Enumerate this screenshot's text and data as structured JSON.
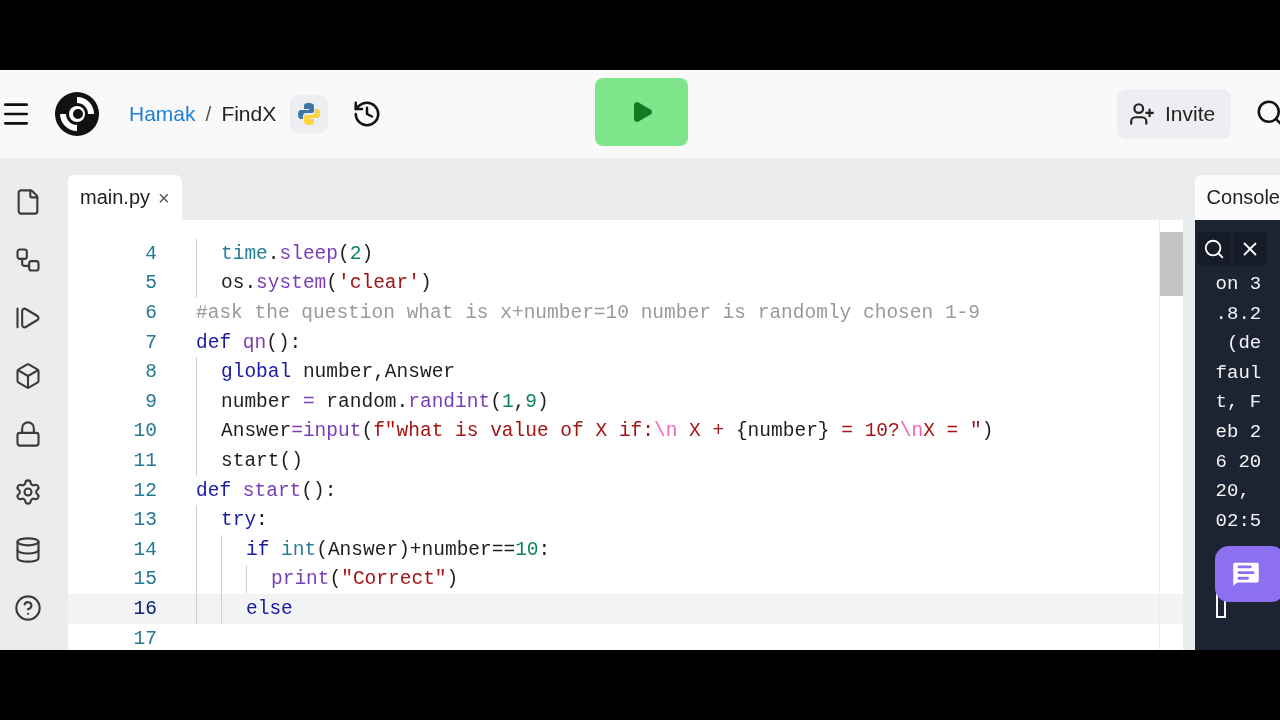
{
  "header": {
    "owner": "Hamak",
    "separator": "/",
    "project": "FindX",
    "invite_label": "Invite"
  },
  "sidebar": {
    "items": [
      {
        "kind": "files"
      },
      {
        "kind": "git"
      },
      {
        "kind": "debugger"
      },
      {
        "kind": "packages"
      },
      {
        "kind": "secrets"
      },
      {
        "kind": "settings"
      },
      {
        "kind": "database"
      },
      {
        "kind": "help"
      }
    ]
  },
  "editor_tabs": [
    {
      "label": "main.py",
      "selected": true,
      "close": "×"
    }
  ],
  "code": {
    "lines": [
      {
        "children": [
          {
            "number": "4",
            "current": false,
            "tokens": [
              {
                "text": "time",
                "kind": "builtin"
              },
              {
                "text": ".",
                "kind": "plain"
              },
              {
                "text": "sleep",
                "kind": "function"
              },
              {
                "text": "(",
                "kind": "plain"
              },
              {
                "text": "2",
                "kind": "number"
              },
              {
                "text": ")",
                "kind": "plain"
              }
            ]
          },
          {
            "number": "5",
            "current": false,
            "tokens": [
              {
                "text": "os.",
                "kind": "plain"
              },
              {
                "text": "system",
                "kind": "function"
              },
              {
                "text": "(",
                "kind": "plain"
              },
              {
                "text": "'clear'",
                "kind": "string"
              },
              {
                "text": ")",
                "kind": "plain"
              }
            ]
          }
        ]
      },
      {
        "number": "6",
        "current": false,
        "tokens": [
          {
            "text": "#ask the question what is x+number=10 number is randomly chosen 1-9",
            "kind": "comment"
          }
        ]
      },
      {
        "number": "7",
        "current": false,
        "tokens": [
          {
            "text": "def ",
            "kind": "keyword"
          },
          {
            "text": "qn",
            "kind": "function"
          },
          {
            "text": "():",
            "kind": "plain"
          }
        ],
        "children": [
          {
            "number": "8",
            "current": false,
            "tokens": [
              {
                "text": "global ",
                "kind": "keyword"
              },
              {
                "text": "number,Answer",
                "kind": "plain"
              }
            ]
          },
          {
            "number": "9",
            "current": false,
            "tokens": [
              {
                "text": "number ",
                "kind": "plain"
              },
              {
                "text": "=",
                "kind": "operator"
              },
              {
                "text": " random.",
                "kind": "plain"
              },
              {
                "text": "randint",
                "kind": "function"
              },
              {
                "text": "(",
                "kind": "plain"
              },
              {
                "text": "1",
                "kind": "number"
              },
              {
                "text": ",",
                "kind": "plain"
              },
              {
                "text": "9",
                "kind": "number"
              },
              {
                "text": ")",
                "kind": "plain"
              }
            ]
          },
          {
            "number": "10",
            "current": false,
            "tokens": [
              {
                "text": "Answer",
                "kind": "plain"
              },
              {
                "text": "=",
                "kind": "operator"
              },
              {
                "text": "input",
                "kind": "function"
              },
              {
                "text": "(",
                "kind": "plain"
              },
              {
                "text": "f\"what is value of X if:",
                "kind": "string"
              },
              {
                "text": "\\n",
                "kind": "escape"
              },
              {
                "text": " X + ",
                "kind": "string"
              },
              {
                "text": "{number}",
                "kind": "plain"
              },
              {
                "text": " = 10?",
                "kind": "string"
              },
              {
                "text": "\\n",
                "kind": "escape"
              },
              {
                "text": "X = \"",
                "kind": "string"
              },
              {
                "text": ")",
                "kind": "plain"
              }
            ]
          },
          {
            "number": "11",
            "current": false,
            "tokens": [
              {
                "text": "start()",
                "kind": "plain"
              }
            ]
          }
        ]
      },
      {
        "number": "12",
        "current": false,
        "tokens": [
          {
            "text": "def ",
            "kind": "keyword"
          },
          {
            "text": "start",
            "kind": "function"
          },
          {
            "text": "():",
            "kind": "plain"
          }
        ],
        "children": [
          {
            "number": "13",
            "current": false,
            "tokens": [
              {
                "text": "try",
                "kind": "keyword"
              },
              {
                "text": ":",
                "kind": "plain"
              }
            ],
            "children": [
              {
                "number": "14",
                "current": false,
                "tokens": [
                  {
                    "text": "if ",
                    "kind": "keyword"
                  },
                  {
                    "text": "int",
                    "kind": "builtin"
                  },
                  {
                    "text": "(Answer)+number==",
                    "kind": "plain"
                  },
                  {
                    "text": "10",
                    "kind": "number"
                  },
                  {
                    "text": ":",
                    "kind": "plain"
                  }
                ],
                "children": [
                  {
                    "number": "15",
                    "current": false,
                    "tokens": [
                      {
                        "text": "print",
                        "kind": "function"
                      },
                      {
                        "text": "(",
                        "kind": "plain"
                      },
                      {
                        "text": "\"Correct\"",
                        "kind": "string"
                      },
                      {
                        "text": ")",
                        "kind": "plain"
                      }
                    ]
                  }
                ]
              },
              {
                "number": "16",
                "current": true,
                "tokens": [
                  {
                    "text": "else",
                    "kind": "keyword"
                  }
                ]
              }
            ]
          }
        ]
      },
      {
        "number": "17",
        "current": false
      }
    ]
  },
  "console": {
    "tab_label": "Console",
    "lines": [
      "on 3",
      ".8.2",
      " (de",
      "faul",
      "t, F",
      "eb 2",
      "6 20",
      "20,",
      "02:5"
    ]
  }
}
